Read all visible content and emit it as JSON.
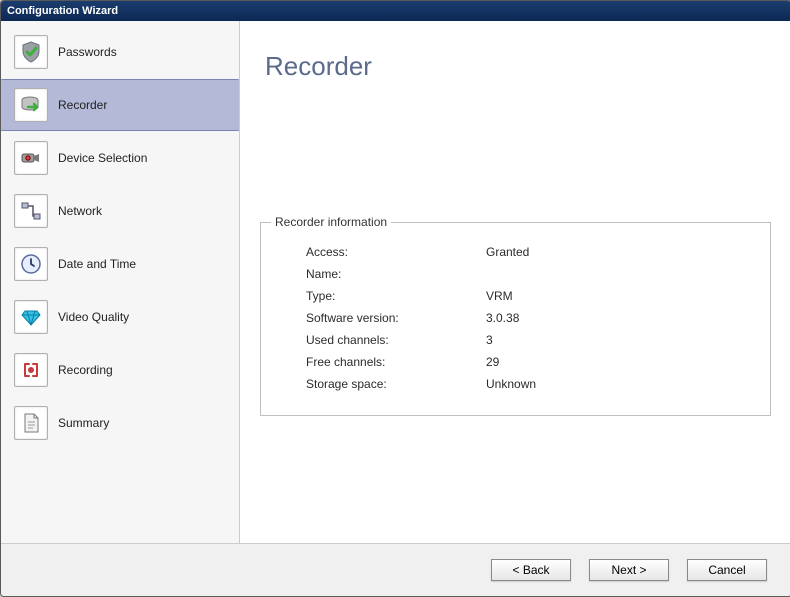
{
  "window": {
    "title": "Configuration Wizard"
  },
  "sidebar": {
    "items": [
      {
        "label": "Passwords"
      },
      {
        "label": "Recorder"
      },
      {
        "label": "Device Selection"
      },
      {
        "label": "Network"
      },
      {
        "label": "Date and Time"
      },
      {
        "label": "Video Quality"
      },
      {
        "label": "Recording"
      },
      {
        "label": "Summary"
      }
    ]
  },
  "page": {
    "title": "Recorder",
    "section_title": "Recorder information",
    "rows": [
      {
        "label": "Access:",
        "value": "Granted"
      },
      {
        "label": "Name:",
        "value": ""
      },
      {
        "label": "Type:",
        "value": "VRM"
      },
      {
        "label": "Software version:",
        "value": "3.0.38"
      },
      {
        "label": "Used channels:",
        "value": "3"
      },
      {
        "label": "Free channels:",
        "value": "29"
      },
      {
        "label": "Storage space:",
        "value": "Unknown"
      }
    ]
  },
  "buttons": {
    "back": "< Back",
    "next": "Next >",
    "cancel": "Cancel"
  }
}
